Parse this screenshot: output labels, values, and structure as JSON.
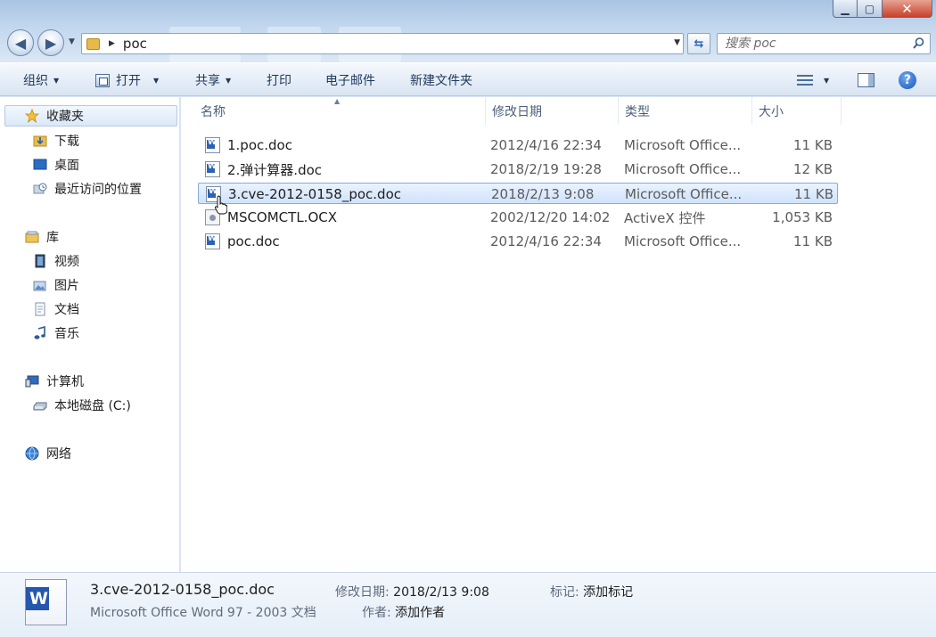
{
  "window": {
    "caption_min": "▁",
    "caption_max": "▢",
    "caption_close": "✕"
  },
  "navigation": {
    "address_folder": "poc",
    "search_placeholder": "搜索 poc"
  },
  "toolbar": {
    "organize": "组织",
    "open": "打开",
    "share": "共享",
    "print": "打印",
    "email": "电子邮件",
    "new_folder": "新建文件夹"
  },
  "sidebar": {
    "favorites": "收藏夹",
    "downloads": "下载",
    "desktop": "桌面",
    "recent": "最近访问的位置",
    "libraries": "库",
    "videos": "视频",
    "pictures": "图片",
    "documents": "文档",
    "music": "音乐",
    "computer": "计算机",
    "local_disk": "本地磁盘 (C:)",
    "network": "网络"
  },
  "columns": {
    "name": "名称",
    "modified": "修改日期",
    "type": "类型",
    "size": "大小"
  },
  "files": [
    {
      "name": "1.poc.doc",
      "modified": "2012/4/16 22:34",
      "type": "Microsoft Office...",
      "size": "11 KB",
      "icon": "word-doc-icon"
    },
    {
      "name": "2.弹计算器.doc",
      "modified": "2018/2/19 19:28",
      "type": "Microsoft Office...",
      "size": "12 KB",
      "icon": "word-doc-icon"
    },
    {
      "name": "3.cve-2012-0158_poc.doc",
      "modified": "2018/2/13 9:08",
      "type": "Microsoft Office...",
      "size": "11 KB",
      "icon": "word-doc-icon",
      "selected": true
    },
    {
      "name": "MSCOMCTL.OCX",
      "modified": "2002/12/20 14:02",
      "type": "ActiveX 控件",
      "size": "1,053 KB",
      "icon": "activex-control-icon"
    },
    {
      "name": "poc.doc",
      "modified": "2012/4/16 22:34",
      "type": "Microsoft Office...",
      "size": "11 KB",
      "icon": "word-doc-icon"
    }
  ],
  "details": {
    "name": "3.cve-2012-0158_poc.doc",
    "type": "Microsoft Office Word 97 - 2003 文档",
    "modified_label": "修改日期:",
    "modified_value": "2018/2/13 9:08",
    "tags_label": "标记:",
    "tags_value": "添加标记",
    "author_label": "作者:",
    "author_value": "添加作者"
  },
  "colors": {
    "selection_fill": "#cfe3fb",
    "selection_border": "#84acdd",
    "toolbar_text": "#1e395b"
  }
}
